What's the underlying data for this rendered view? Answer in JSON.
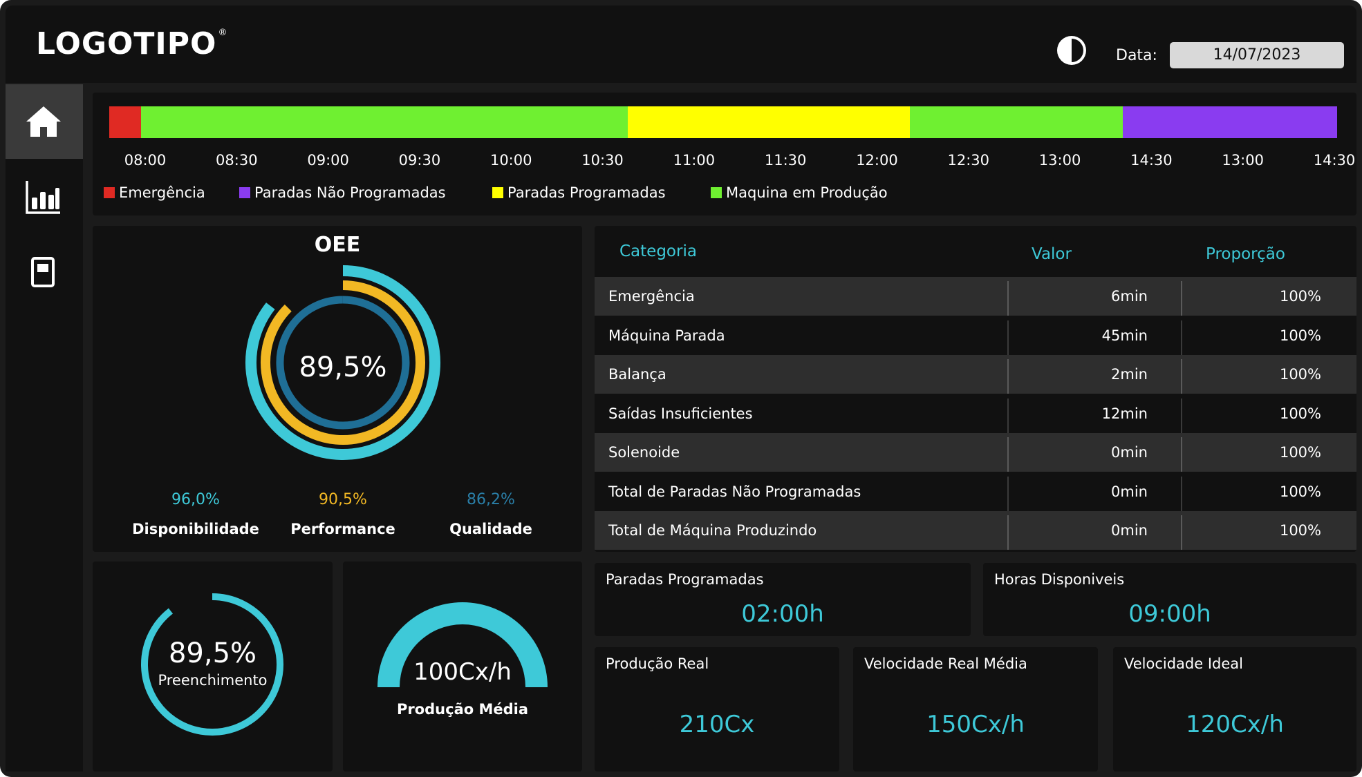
{
  "header": {
    "logo": "LOGOTIPO",
    "logo_mark": "®",
    "date_label": "Data:",
    "date_value": "14/07/2023",
    "theme_icon": "contrast-icon"
  },
  "sidebar": {
    "items": [
      {
        "icon": "home-icon",
        "active": true
      },
      {
        "icon": "bar-chart-icon",
        "active": false
      },
      {
        "icon": "report-icon",
        "active": false
      }
    ]
  },
  "timeline": {
    "segments": [
      {
        "status": "Emergência",
        "start": 0.0,
        "end": 0.026,
        "color": "#e02a23"
      },
      {
        "status": "Maquina em Produção",
        "start": 0.026,
        "end": 0.4225,
        "color": "#6ff031"
      },
      {
        "status": "Paradas Programadas",
        "start": 0.4225,
        "end": 0.6518,
        "color": "#ffff00"
      },
      {
        "status": "Maquina em Produção",
        "start": 0.6518,
        "end": 0.8255,
        "color": "#6ff031"
      },
      {
        "status": "Paradas Não Programadas",
        "start": 0.8255,
        "end": 1.0,
        "color": "#8a3cf0"
      }
    ],
    "ticks": [
      "08:00",
      "08:30",
      "09:00",
      "09:30",
      "10:00",
      "10:30",
      "11:00",
      "11:30",
      "12:00",
      "12:30",
      "13:00",
      "14:30",
      "13:00",
      "14:30"
    ],
    "legend": [
      {
        "label": "Emergência",
        "color": "#e02a23"
      },
      {
        "label": "Paradas Não Programadas",
        "color": "#8a3cf0"
      },
      {
        "label": "Paradas Programadas",
        "color": "#ffff00"
      },
      {
        "label": "Maquina em Produção",
        "color": "#6ff031"
      }
    ]
  },
  "oee": {
    "title": "OEE",
    "value": "89,5%",
    "kpis": [
      {
        "value": "96,0%",
        "label": "Disponibilidade",
        "color": "#3ec9d8"
      },
      {
        "value": "90,5%",
        "label": "Performance",
        "color": "#f2b824"
      },
      {
        "value": "86,2%",
        "label": "Qualidade",
        "color": "#2a7fa8"
      }
    ]
  },
  "table": {
    "headers": {
      "category": "Categoria",
      "value": "Valor",
      "proportion": "Proporção"
    },
    "rows": [
      {
        "category": "Emergência",
        "value": "6min",
        "proportion": "100%"
      },
      {
        "category": "Máquina Parada",
        "value": "45min",
        "proportion": "100%"
      },
      {
        "category": "Balança",
        "value": "2min",
        "proportion": "100%"
      },
      {
        "category": "Saídas Insuficientes",
        "value": "12min",
        "proportion": "100%"
      },
      {
        "category": "Solenoide",
        "value": "0min",
        "proportion": "100%"
      },
      {
        "category": "Total de Paradas Não Programadas",
        "value": "0min",
        "proportion": "100%"
      },
      {
        "category": "Total de Máquina Produzindo",
        "value": "0min",
        "proportion": "100%"
      }
    ]
  },
  "fill": {
    "value": "89,5%",
    "label": "Preenchimento",
    "fraction": 0.895,
    "color": "#3ec9d8"
  },
  "gauge": {
    "value": "100Cx/h",
    "label": "Produção Média",
    "color": "#3ec9d8"
  },
  "stats": {
    "scheduled_stops": {
      "title": "Paradas Programadas",
      "value": "02:00h"
    },
    "available_hours": {
      "title": "Horas Disponiveis",
      "value": "09:00h"
    },
    "real_production": {
      "title": "Produção Real",
      "value": "210Cx"
    },
    "avg_real_speed": {
      "title": "Velocidade Real Média",
      "value": "150Cx/h"
    },
    "ideal_speed": {
      "title": "Velocidade Ideal",
      "value": "120Cx/h"
    }
  },
  "colors": {
    "accent": "#3ec9d8",
    "performance": "#f2b824",
    "quality": "#2a7fa8",
    "panel": "#111111",
    "background": "#1b1b1b"
  }
}
